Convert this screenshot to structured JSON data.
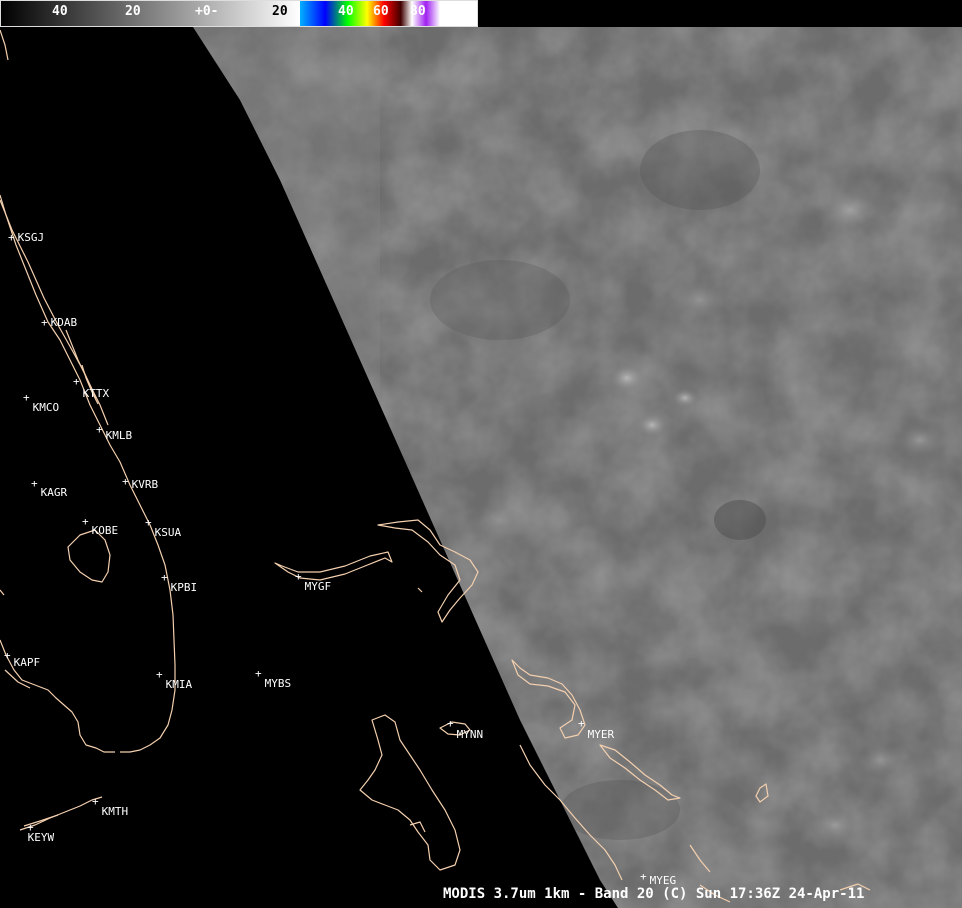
{
  "colorbar": {
    "labels": [
      "40",
      "20",
      "+0-",
      "20",
      "40",
      "60",
      "80"
    ]
  },
  "stations": [
    {
      "id": "KSGJ"
    },
    {
      "id": "KDAB"
    },
    {
      "id": "KMCO"
    },
    {
      "id": "KTTX"
    },
    {
      "id": "KMLB"
    },
    {
      "id": "KVRB"
    },
    {
      "id": "KAGR"
    },
    {
      "id": "KOBE"
    },
    {
      "id": "KSUA"
    },
    {
      "id": "KPBI"
    },
    {
      "id": "MYGF"
    },
    {
      "id": "KAPF"
    },
    {
      "id": "KMIA"
    },
    {
      "id": "MYBS"
    },
    {
      "id": "MYNN"
    },
    {
      "id": "MYER"
    },
    {
      "id": "KMTH"
    },
    {
      "id": "KEYW"
    },
    {
      "id": "MYEG"
    }
  ],
  "caption": "MODIS 3.7um 1km - Band 20 (C)  Sun 17:36Z 24-Apr-11",
  "colors": {
    "background": "#000000",
    "swath": "#6b6b6b",
    "coastline": "#f3cfae",
    "text": "#ffffff"
  }
}
